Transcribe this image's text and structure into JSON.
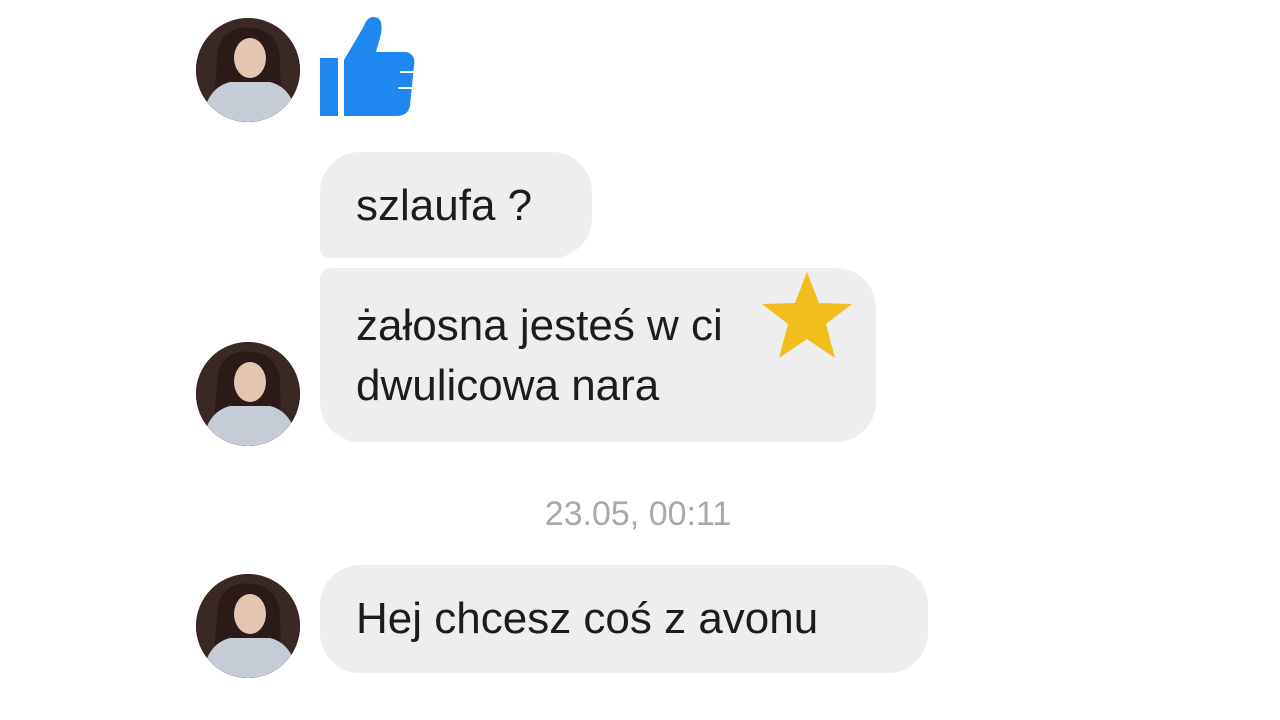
{
  "messages": [
    {
      "text": "szlaufa ?"
    },
    {
      "lines": [
        "żałosna jesteś w ci",
        "dwulicowa nara"
      ]
    },
    {
      "text": "Hej chcesz coś z avonu"
    }
  ],
  "timestamp": "23.05, 00:11",
  "icons": {
    "reaction": "thumbs-up-icon",
    "overlay": "star-icon"
  },
  "colors": {
    "bubble": "#eeeeef",
    "like": "#1e88f0",
    "star": "#f2bd1d",
    "timestamp": "#a9a9ab"
  }
}
